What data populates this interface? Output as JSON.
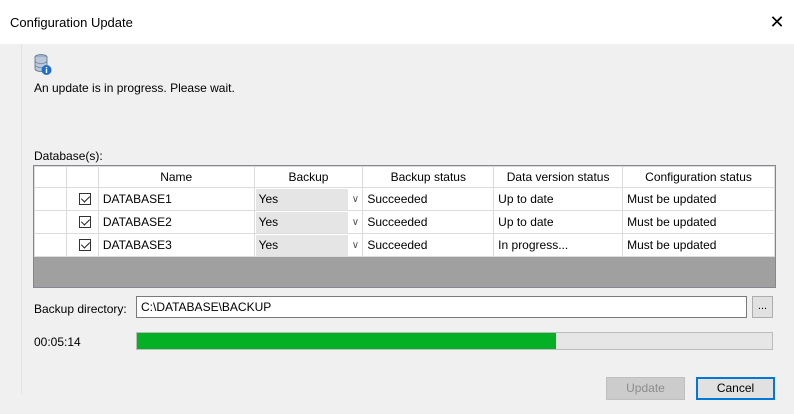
{
  "window": {
    "title": "Configuration Update",
    "close_glyph": "✕"
  },
  "status_message": "An update is in progress.  Please wait.",
  "databases_label": "Database(s):",
  "table": {
    "headers": [
      "",
      "",
      "Name",
      "Backup",
      "Backup status",
      "Data version status",
      "Configuration status"
    ],
    "rows": [
      {
        "checked": true,
        "name": "DATABASE1",
        "backup": "Yes",
        "backup_status": "Succeeded",
        "data_version_status": "Up to date",
        "configuration_status": "Must be updated"
      },
      {
        "checked": true,
        "name": "DATABASE2",
        "backup": "Yes",
        "backup_status": "Succeeded",
        "data_version_status": "Up to date",
        "configuration_status": "Must be updated"
      },
      {
        "checked": true,
        "name": "DATABASE3",
        "backup": "Yes",
        "backup_status": "Succeeded",
        "data_version_status": "In progress...",
        "configuration_status": "Must be updated"
      }
    ]
  },
  "backup_directory": {
    "label": "Backup directory:",
    "value": "C:\\DATABASE\\BACKUP",
    "browse_label": "..."
  },
  "elapsed_time": "00:05:14",
  "progress_fraction": 0.66,
  "buttons": {
    "update": "Update",
    "cancel": "Cancel"
  },
  "colors": {
    "progress": "#06b025",
    "focus_border": "#0078d7"
  },
  "icons": {
    "window_icon": "database-info-icon"
  }
}
